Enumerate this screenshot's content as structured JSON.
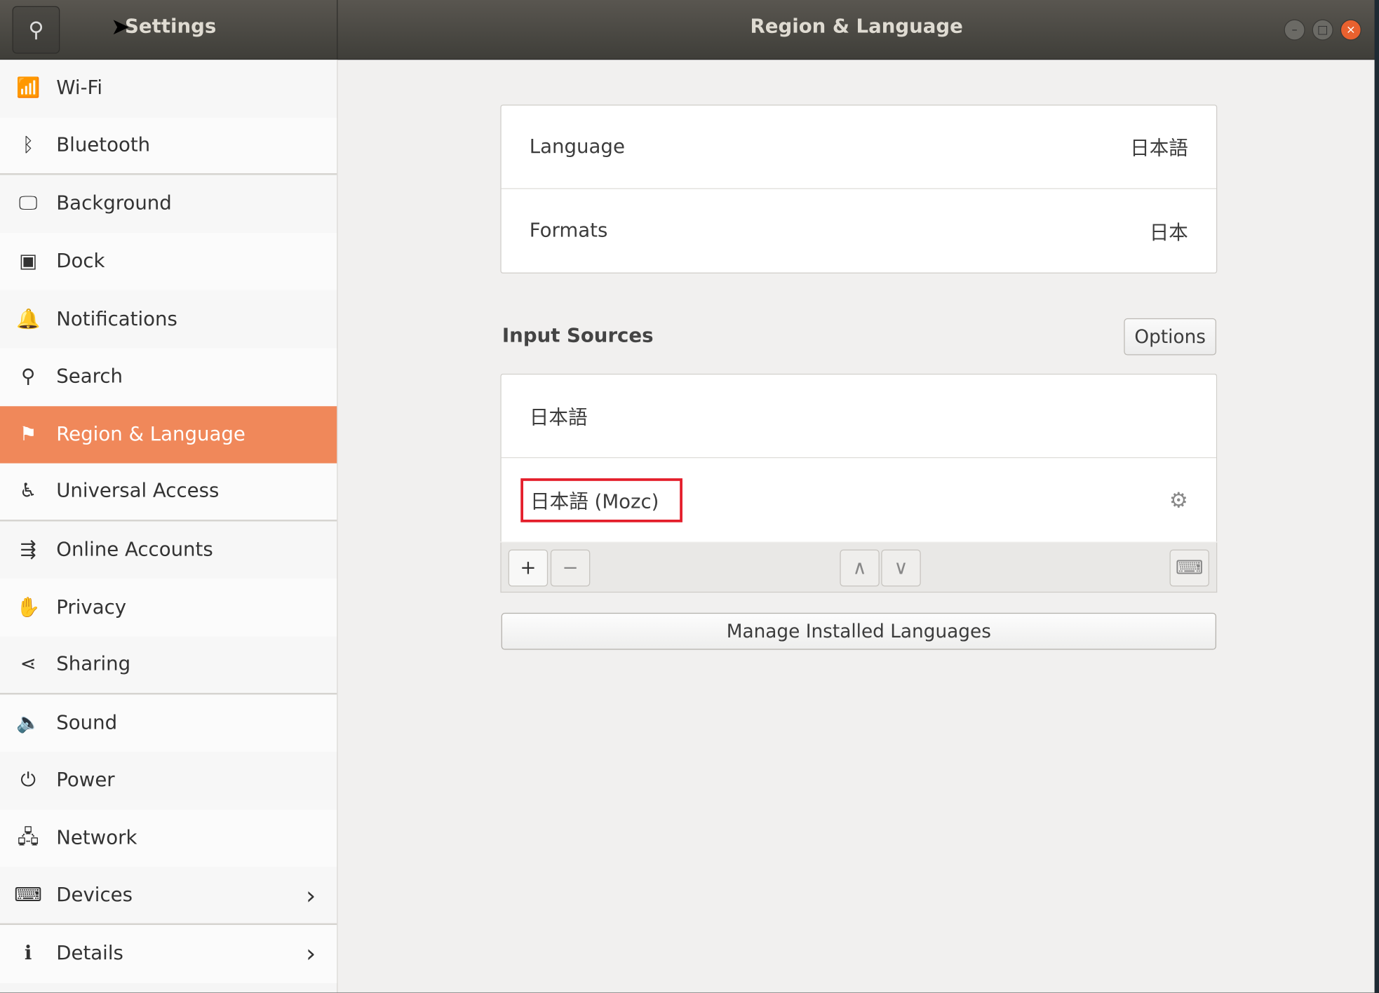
{
  "window": {
    "app_title": "Settings",
    "title": "Region & Language"
  },
  "sidebar": {
    "items": [
      {
        "label": "Wi-Fi",
        "icon": "wifi-icon",
        "glyph": "📶"
      },
      {
        "label": "Bluetooth",
        "icon": "bluetooth-icon",
        "glyph": "ᛒ"
      },
      {
        "label": "Background",
        "icon": "background-icon",
        "glyph": "🖵"
      },
      {
        "label": "Dock",
        "icon": "dock-icon",
        "glyph": "▣"
      },
      {
        "label": "Notifications",
        "icon": "bell-icon",
        "glyph": "🔔"
      },
      {
        "label": "Search",
        "icon": "search-icon",
        "glyph": "⚲"
      },
      {
        "label": "Region & Language",
        "icon": "flag-icon",
        "glyph": "⚑"
      },
      {
        "label": "Universal Access",
        "icon": "accessibility-icon",
        "glyph": "♿"
      },
      {
        "label": "Online Accounts",
        "icon": "online-accounts-icon",
        "glyph": "⇶"
      },
      {
        "label": "Privacy",
        "icon": "hand-icon",
        "glyph": "✋"
      },
      {
        "label": "Sharing",
        "icon": "share-icon",
        "glyph": "⋖"
      },
      {
        "label": "Sound",
        "icon": "speaker-icon",
        "glyph": "🔈"
      },
      {
        "label": "Power",
        "icon": "power-plug-icon",
        "glyph": "⏻"
      },
      {
        "label": "Network",
        "icon": "network-icon",
        "glyph": "🖧"
      },
      {
        "label": "Devices",
        "icon": "devices-icon",
        "glyph": "⌨"
      },
      {
        "label": "Details",
        "icon": "info-icon",
        "glyph": "ℹ"
      }
    ]
  },
  "language": {
    "label": "Language",
    "value": "日本語"
  },
  "formats": {
    "label": "Formats",
    "value": "日本"
  },
  "input_sources": {
    "title": "Input Sources",
    "options_label": "Options",
    "items": [
      "日本語",
      "日本語 (Mozc)"
    ]
  },
  "manage_label": "Manage Installed Languages",
  "accent": "#f0885a"
}
